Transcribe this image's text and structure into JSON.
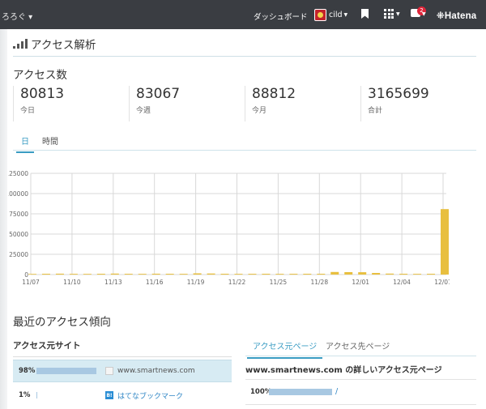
{
  "topbar": {
    "blog_name": "ろろぐ",
    "dashboard_label": "ダッシュボード",
    "user_name": "cild",
    "notification_count": "2",
    "brand": "Hatena"
  },
  "page": {
    "title": "アクセス解析"
  },
  "access_count": {
    "title": "アクセス数",
    "stats": [
      {
        "value": "80813",
        "label": "今日"
      },
      {
        "value": "83067",
        "label": "今週"
      },
      {
        "value": "88812",
        "label": "今月"
      },
      {
        "value": "3165699",
        "label": "合計"
      }
    ]
  },
  "period_tabs": [
    {
      "label": "日",
      "active": true
    },
    {
      "label": "時間",
      "active": false
    }
  ],
  "chart_data": {
    "type": "bar",
    "categories": [
      "11/07",
      "11/08",
      "11/09",
      "11/10",
      "11/11",
      "11/12",
      "11/13",
      "11/14",
      "11/15",
      "11/16",
      "11/17",
      "11/18",
      "11/19",
      "11/20",
      "11/21",
      "11/22",
      "11/23",
      "11/24",
      "11/25",
      "11/26",
      "11/27",
      "11/28",
      "11/29",
      "11/30",
      "12/01",
      "12/02",
      "12/03",
      "12/04",
      "12/05",
      "12/06",
      "12/07"
    ],
    "tick_labels": [
      "11/07",
      "11/10",
      "11/13",
      "11/16",
      "11/19",
      "11/22",
      "11/25",
      "11/28",
      "12/01",
      "12/04",
      "12/07"
    ],
    "values": [
      800,
      1000,
      1100,
      900,
      850,
      1000,
      1200,
      950,
      900,
      1050,
      1000,
      900,
      1500,
      1300,
      1000,
      900,
      950,
      1000,
      900,
      950,
      1000,
      1000,
      3200,
      3000,
      2900,
      2000,
      1200,
      1000,
      900,
      1000,
      80813
    ],
    "ylim": [
      0,
      125000
    ],
    "yticks": [
      0,
      25000,
      50000,
      75000,
      100000,
      125000
    ],
    "grid": true,
    "bar_color": "#e8bf3f"
  },
  "trend": {
    "title": "最近のアクセス傾向",
    "sources_title": "アクセス元サイト",
    "sources": [
      {
        "percent": "98%",
        "bar_fraction": 0.98,
        "site": "www.smartnews.com",
        "is_link": false
      },
      {
        "percent": "1%",
        "bar_fraction": 0.01,
        "site": "はてなブックマーク",
        "is_link": true
      }
    ],
    "page_tabs": [
      {
        "label": "アクセス元ページ",
        "active": true
      },
      {
        "label": "アクセス先ページ",
        "active": false
      }
    ],
    "detail_title": "www.smartnews.com の詳しいアクセス元ページ",
    "detail_rows": [
      {
        "percent": "100%",
        "path": "/"
      }
    ]
  }
}
